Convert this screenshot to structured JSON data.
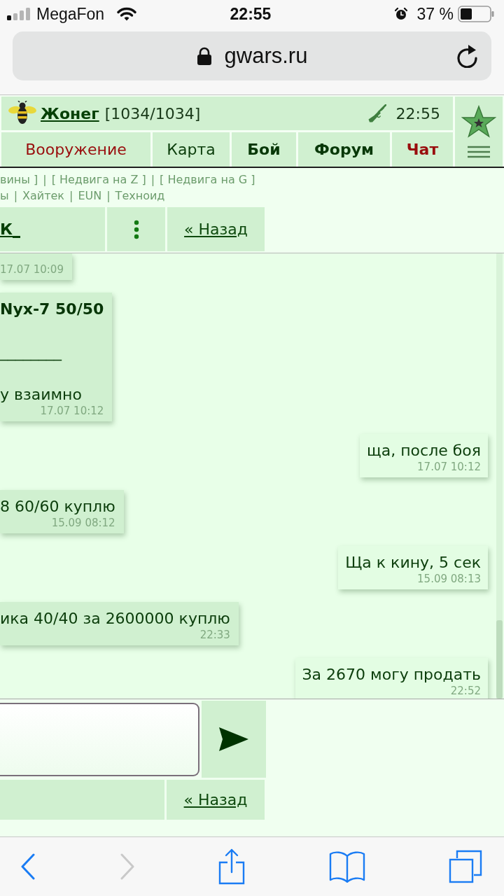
{
  "status_bar": {
    "carrier": "MegaFon",
    "time": "22:55",
    "battery": "37 %"
  },
  "address_bar": {
    "url": "gwars.ru"
  },
  "game_header": {
    "player": {
      "name": "Жонег",
      "hp": "[1034/1034]"
    },
    "server_time": "22:55"
  },
  "nav_tabs": [
    {
      "label": "Вооружение",
      "kind": "alert",
      "selected": false
    },
    {
      "label": "Карта",
      "kind": "plain",
      "selected": false
    },
    {
      "label": "Бой",
      "kind": "strong",
      "selected": false
    },
    {
      "label": "Форум",
      "kind": "strong",
      "selected": false
    },
    {
      "label": "Чат",
      "kind": "strong",
      "selected": true
    }
  ],
  "quick_links": {
    "separator": "|",
    "lines": [
      [
        "вины ]",
        "[ Недвига на Z ]",
        "[ Недвига на G ]"
      ],
      [
        "ы",
        "Хайтек",
        "EUN",
        "Техноид"
      ]
    ]
  },
  "chat_header": {
    "contact": "К_",
    "back": "« Назад"
  },
  "messages": [
    {
      "kind": "incoming",
      "time": "17.07 10:09"
    },
    {
      "kind": "incoming",
      "lines": [
        {
          "kind": "title",
          "text": "Nyx-7 50/50"
        },
        {
          "kind": "rule",
          "text": "________"
        },
        {
          "kind": "text",
          "text": "у взаимно"
        }
      ],
      "time": "17.07 10:12"
    },
    {
      "kind": "outgoing",
      "lines": [
        {
          "kind": "text",
          "text": "ща, после боя"
        }
      ],
      "time": "17.07 10:12"
    },
    {
      "kind": "incoming",
      "lines": [
        {
          "kind": "text",
          "text": "8 60/60 куплю"
        }
      ],
      "time": "15.09 08:12"
    },
    {
      "kind": "outgoing",
      "lines": [
        {
          "kind": "text",
          "text": "Ща к кину, 5 сек"
        }
      ],
      "time": "15.09 08:13"
    },
    {
      "kind": "incoming",
      "lines": [
        {
          "kind": "text",
          "text": "ика 40/40 за 2600000 куплю"
        }
      ],
      "time": "22:33"
    },
    {
      "kind": "outgoing",
      "lines": [
        {
          "kind": "text",
          "text": "За 2670 могу продать"
        }
      ],
      "time": "22:52"
    }
  ],
  "footer": {
    "back": "« Назад"
  },
  "browser_toolbar": [
    {
      "kind": "back",
      "disabled": false
    },
    {
      "kind": "forward",
      "disabled": true
    },
    {
      "kind": "share",
      "disabled": false
    },
    {
      "kind": "bookmarks",
      "disabled": false
    },
    {
      "kind": "tabs",
      "disabled": false
    }
  ]
}
